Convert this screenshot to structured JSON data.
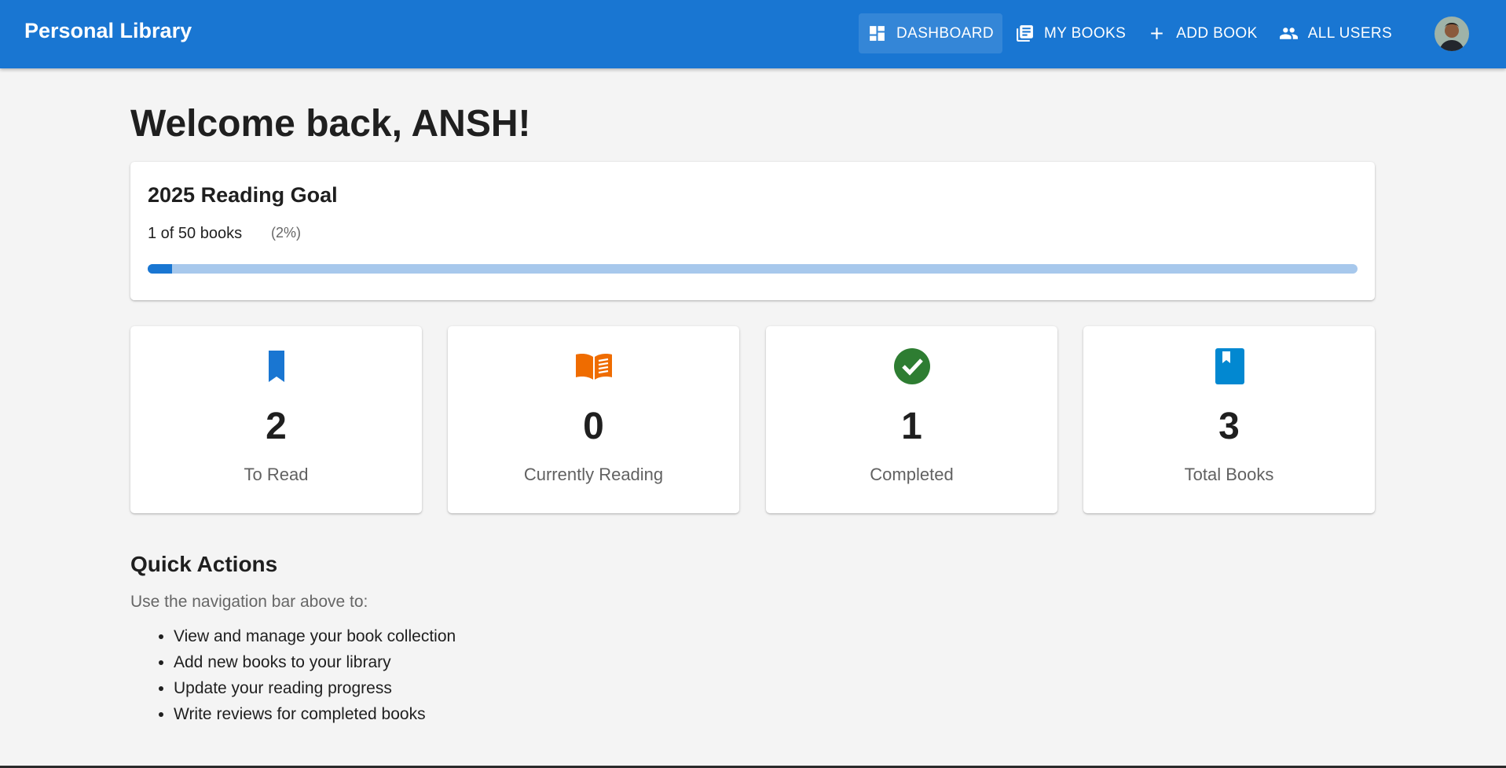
{
  "app": {
    "title": "Personal Library"
  },
  "nav": {
    "items": [
      {
        "label": "DASHBOARD",
        "icon": "dashboard-icon",
        "active": true
      },
      {
        "label": "MY BOOKS",
        "icon": "library-books-icon",
        "active": false
      },
      {
        "label": "ADD BOOK",
        "icon": "plus-icon",
        "active": false
      },
      {
        "label": "ALL USERS",
        "icon": "people-icon",
        "active": false
      }
    ],
    "avatar": "user-avatar"
  },
  "welcome": "Welcome back, ANSH!",
  "goal": {
    "title": "2025 Reading Goal",
    "count_text": "1 of 50 books",
    "percent_text": "(2%)",
    "progress": 0.02
  },
  "stats": [
    {
      "value": "2",
      "label": "To Read",
      "icon": "bookmark-icon",
      "color": "#1976d2"
    },
    {
      "value": "0",
      "label": "Currently Reading",
      "icon": "open-book-icon",
      "color": "#ef6c00"
    },
    {
      "value": "1",
      "label": "Completed",
      "icon": "check-circle-icon",
      "color": "#2e7d32"
    },
    {
      "value": "3",
      "label": "Total Books",
      "icon": "book-icon",
      "color": "#0288d1"
    }
  ],
  "quick_actions": {
    "title": "Quick Actions",
    "subtitle": "Use the navigation bar above to:",
    "items": [
      "View and manage your book collection",
      "Add new books to your library",
      "Update your reading progress",
      "Write reviews for completed books"
    ]
  },
  "colors": {
    "primary": "#1976d2",
    "background": "#f4f4f4",
    "progress_track": "#a7c8ec"
  }
}
